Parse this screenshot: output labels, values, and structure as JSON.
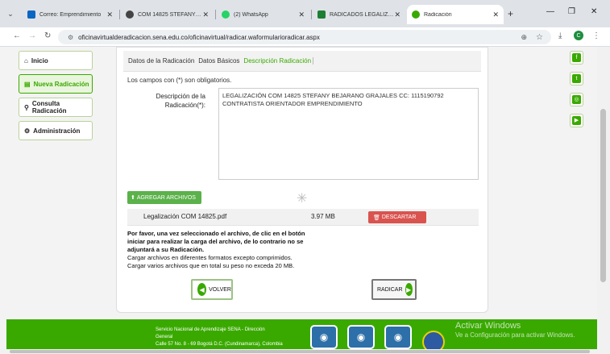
{
  "browser": {
    "tabs": [
      {
        "label": "Correo: Emprendimiento",
        "favicon_color": "#0a66c2"
      },
      {
        "label": "COM 14825 STEFANY BE",
        "favicon_color": "#444444"
      },
      {
        "label": "(2) WhatsApp",
        "favicon_color": "#25d366"
      },
      {
        "label": "RADICADOS LEGALIZAC",
        "favicon_color": "#1e7e34"
      },
      {
        "label": "Radicación",
        "favicon_color": "#39a900"
      }
    ],
    "url": "oficinavirtualderadicacion.sena.edu.co/oficinavirtual/radicar.waformularioradicar.aspx",
    "profile_initial": "C"
  },
  "sidebar": {
    "items": [
      {
        "label": "Inicio",
        "icon": "home-icon"
      },
      {
        "label": "Nueva Radicación",
        "icon": "list-icon"
      },
      {
        "label": "Consulta Radicación",
        "icon": "search-icon"
      },
      {
        "label": "Administración",
        "icon": "gears-icon"
      }
    ]
  },
  "form": {
    "tabs": [
      "Datos de la Radicación",
      "Datos Básicos",
      "Descripción Radicación"
    ],
    "required_note": "Los campos con (*) son obligatorios.",
    "desc_label_1": "Descripción de la",
    "desc_label_2": "Radicación(*):",
    "desc_value": "LEGALIZACIÓN COM 14825 STEFANY BEJARANO GRAJALES CC: 1115190792 CONTRATISTA ORIENTADOR EMPRENDIMIENTO",
    "add_files_label": "AGREGAR ARCHIVOS",
    "file_name": "Legalización COM 14825.pdf",
    "file_size": "3.97 MB",
    "discard_label": "DESCARTAR",
    "info_bold_1": "Por favor, una vez seleccionado el archivo, de clic en el botón",
    "info_bold_2": "iniciar para realizar la carga del archivo, de lo contrario no se",
    "info_bold_3": "adjuntará a su Radicación.",
    "info_line_4": "Cargar archivos en diferentes formatos excepto comprimidos.",
    "info_line_5": "Cargar varios archivos que en total su peso no exceda 20 MB.",
    "back_label": "VOLVER",
    "submit_label": "RADICAR"
  },
  "social": [
    "facebook-icon",
    "twitter-icon",
    "instagram-icon",
    "youtube-icon"
  ],
  "footer": {
    "line1": "Servicio Nacional de Aprendizaje SENA - Dirección",
    "line2": "General",
    "line3": "Calle 57 No. 8 - 69 Bogotá D.C. (Cundinamarca), Colombia"
  },
  "watermark": {
    "title": "Activar Windows",
    "subtitle": "Ve a Configuración para activar Windows."
  },
  "colors": {
    "accent": "#39a900",
    "danger": "#d9534f"
  }
}
